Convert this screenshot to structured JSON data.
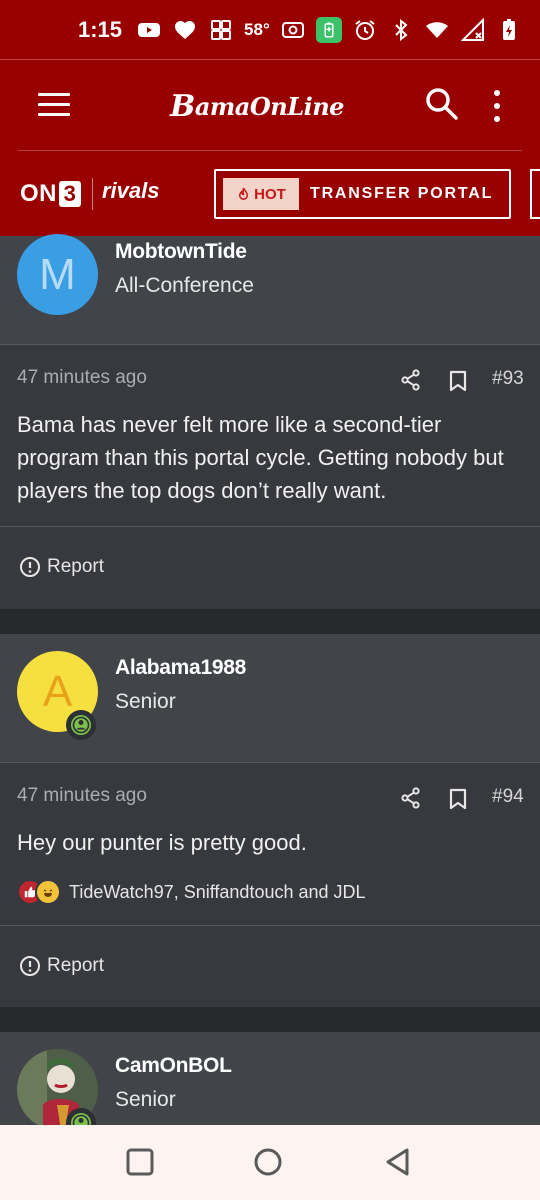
{
  "status_bar": {
    "time": "1:15",
    "temperature": "58°",
    "icons": [
      "youtube-icon",
      "heart-icon",
      "apps-icon",
      "radio-icon",
      "battery-saver-icon",
      "alarm-icon",
      "bluetooth-icon",
      "wifi-icon",
      "signal-icon",
      "battery-charging-icon"
    ]
  },
  "header": {
    "logo_text_b": "B",
    "logo_text_rest": "amaOnLine",
    "accent_color": "#990000"
  },
  "nav": {
    "on3_text": "ON",
    "on3_num": "3",
    "rivals": "rivals",
    "hot_badge": "HOT",
    "transfer_portal": "TRANSFER PORTAL"
  },
  "posts": [
    {
      "username": "MobtownTide",
      "rank": "All-Conference",
      "avatar_letter": "M",
      "avatar_color": "#3a9ee5",
      "time": "47 minutes ago",
      "number": "#93",
      "text": "Bama has never felt more like a second-tier program than this portal cycle. Getting nobody but players the top dogs don’t really want.",
      "report": "Report"
    },
    {
      "username": "Alabama1988",
      "rank": "Senior",
      "avatar_letter": "A",
      "avatar_color": "#f6e040",
      "time": "47 minutes ago",
      "number": "#94",
      "text": "Hey our punter is pretty good.",
      "reactions": "TideWatch97, Sniffandtouch and JDL",
      "report": "Report"
    },
    {
      "username": "CamOnBOL",
      "rank": "Senior"
    }
  ]
}
